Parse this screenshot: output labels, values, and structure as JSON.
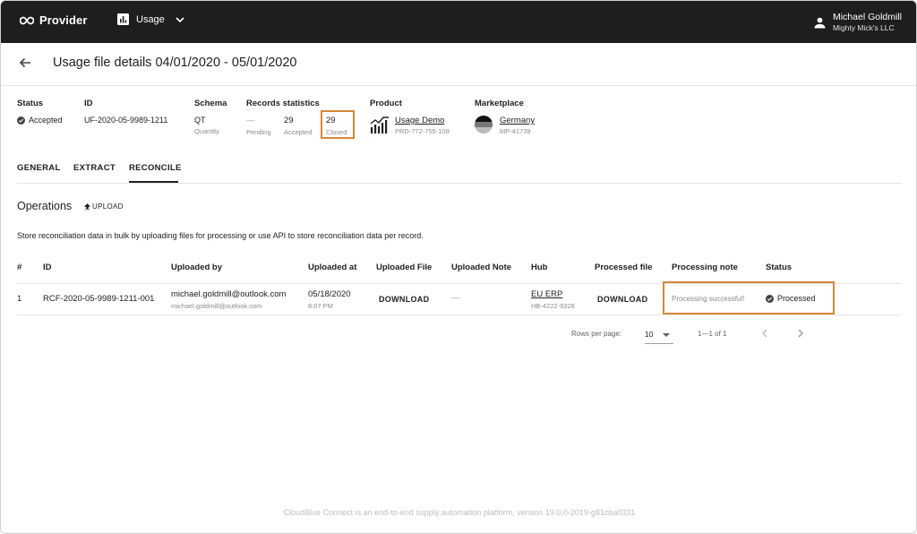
{
  "topbar": {
    "brand": "Provider",
    "nav_label": "Usage",
    "user_name": "Michael Goldmill",
    "user_company": "Mighty Mick's LLC"
  },
  "header": {
    "title": "Usage file details 04/01/2020 - 05/01/2020"
  },
  "info": {
    "status": {
      "heading": "Status",
      "value": "Accepted"
    },
    "id": {
      "heading": "ID",
      "value": "UF-2020-05-9989-1211"
    },
    "schema": {
      "heading": "Schema",
      "value": "QT",
      "sub": "Quantity"
    },
    "records": {
      "heading": "Records statistics",
      "pending_value": "—",
      "pending_label": "Pending",
      "accepted_value": "29",
      "accepted_label": "Accepted",
      "closed_value": "29",
      "closed_label": "Closed"
    },
    "product": {
      "heading": "Product",
      "name": "Usage Demo",
      "id": "PRD-772-755-108"
    },
    "marketplace": {
      "heading": "Marketplace",
      "name": "Germany",
      "id": "MP-41739"
    }
  },
  "tabs": [
    "GENERAL",
    "EXTRACT",
    "RECONCILE"
  ],
  "operations": {
    "title": "Operations",
    "upload_label": "UPLOAD",
    "description": "Store reconciliation data in bulk by uploading files for processing or use API to store reconciliation data per record."
  },
  "table": {
    "headers": [
      "#",
      "ID",
      "Uploaded by",
      "Uploaded at",
      "Uploaded File",
      "Uploaded Note",
      "Hub",
      "Processed file",
      "Processing note",
      "Status"
    ],
    "rows": [
      {
        "num": "1",
        "id": "RCF-2020-05-9989-1211-001",
        "uploaded_by": "michael.goldmill@outlook.com",
        "uploaded_by_sub": "michael.goldmill@outlook.com",
        "uploaded_at": "05/18/2020",
        "uploaded_time": "8:07 PM",
        "uploaded_file": "DOWNLOAD",
        "uploaded_note": "—",
        "hub": "EU ERP",
        "hub_id": "HB-4222-9328",
        "processed_file": "DOWNLOAD",
        "processing_note": "Processing successful!",
        "status": "Processed"
      }
    ]
  },
  "pagination": {
    "rows_label": "Rows per page:",
    "rows_value": "10",
    "range": "1—1 of 1"
  },
  "footer": "CloudBlue Connect is an end-to-end supply automation platform, version 19.0.0-2019-g81cba0331",
  "colors": {
    "topbar": "#1e1e1e",
    "highlight": "#d4883a"
  }
}
